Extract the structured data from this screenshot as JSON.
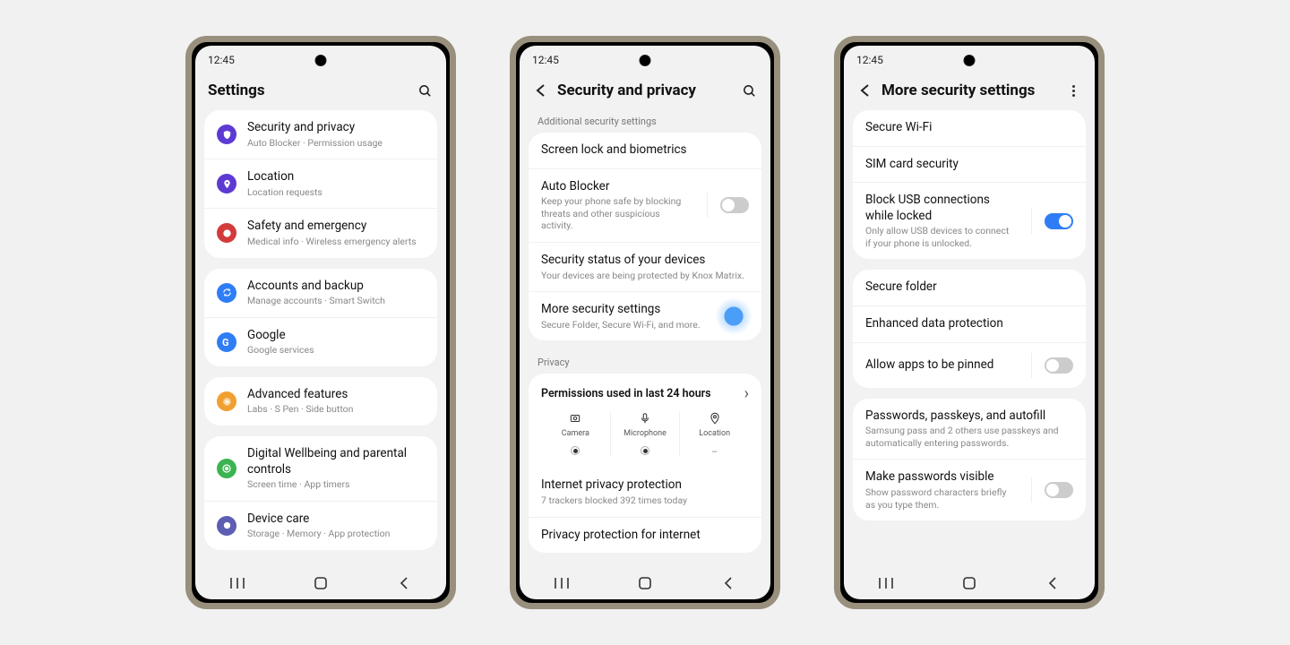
{
  "status_time": "12:45",
  "screen1": {
    "title": "Settings",
    "groups": [
      [
        {
          "icon_bg": "#5d3bd3",
          "icon": "shield",
          "title": "Security and privacy",
          "sub": "Auto Blocker  ·  Permission usage"
        },
        {
          "icon_bg": "#5d3bd3",
          "icon": "pin",
          "title": "Location",
          "sub": "Location requests"
        },
        {
          "icon_bg": "#d33b3b",
          "icon": "sos",
          "title": "Safety and emergency",
          "sub": "Medical info  ·  Wireless emergency alerts"
        }
      ],
      [
        {
          "icon_bg": "#2f7df6",
          "icon": "sync",
          "title": "Accounts and backup",
          "sub": "Manage accounts  ·  Smart Switch"
        },
        {
          "icon_bg": "#2f7df6",
          "icon": "g",
          "title": "Google",
          "sub": "Google services"
        }
      ],
      [
        {
          "icon_bg": "#f0a030",
          "icon": "gear",
          "title": "Advanced features",
          "sub": "Labs  ·  S Pen  ·  Side button"
        }
      ],
      [
        {
          "icon_bg": "#3bb350",
          "icon": "well",
          "title": "Digital Wellbeing and parental controls",
          "sub": "Screen time  ·  App timers"
        },
        {
          "icon_bg": "#5d5db3",
          "icon": "care",
          "title": "Device care",
          "sub": "Storage  ·  Memory  ·  App protection"
        }
      ]
    ]
  },
  "screen2": {
    "title": "Security and privacy",
    "section": "Additional security settings",
    "items": [
      {
        "title": "Screen lock and biometrics"
      },
      {
        "title": "Auto Blocker",
        "sub": "Keep your phone safe by blocking threats and other suspicious activity.",
        "toggle": false
      },
      {
        "title": "Security status of your devices",
        "sub": "Your devices are being protected by Knox Matrix."
      },
      {
        "title": "More security settings",
        "sub": "Secure Folder, Secure Wi-Fi, and more.",
        "highlight": true
      }
    ],
    "privacy_header": "Privacy",
    "perm_title": "Permissions used in last 24 hours",
    "perms": [
      {
        "label": "Camera",
        "used": true
      },
      {
        "label": "Microphone",
        "used": true
      },
      {
        "label": "Location",
        "used": false
      }
    ],
    "privacy_items": [
      {
        "title": "Internet privacy protection",
        "sub": "7 trackers blocked 392 times today"
      },
      {
        "title": "Privacy protection for internet"
      }
    ]
  },
  "screen3": {
    "title": "More security settings",
    "groups": [
      [
        {
          "title": "Secure Wi-Fi"
        },
        {
          "title": "SIM card security"
        },
        {
          "title": "Block USB connections while locked",
          "sub": "Only allow USB devices to connect if your phone is unlocked.",
          "toggle": true
        }
      ],
      [
        {
          "title": "Secure folder"
        },
        {
          "title": "Enhanced data protection"
        },
        {
          "title": "Allow apps to be pinned",
          "toggle": false
        }
      ],
      [
        {
          "title": "Passwords, passkeys, and autofill",
          "sub": "Samsung pass and 2 others use passkeys and automatically entering passwords."
        },
        {
          "title": "Make passwords visible",
          "sub": "Show password characters briefly as you type them.",
          "toggle": false
        }
      ]
    ]
  }
}
